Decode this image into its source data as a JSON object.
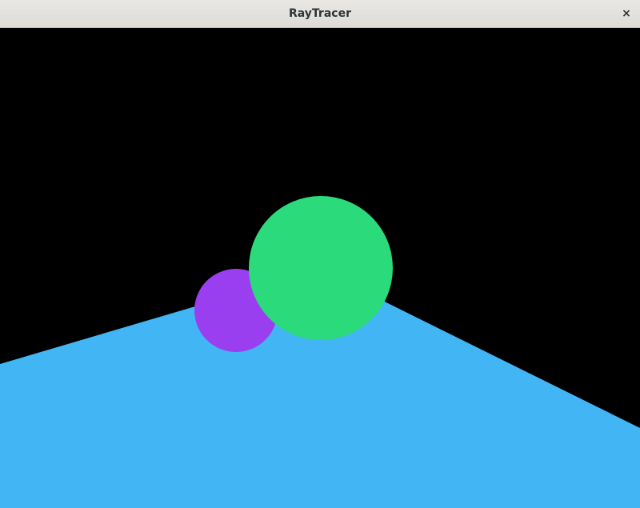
{
  "window": {
    "title": "RayTracer",
    "close_glyph": "×",
    "close_icon": "close-icon"
  },
  "scene": {
    "background_color": "#000000",
    "plane_color": "#42b5f4",
    "spheres": [
      {
        "name": "purple-sphere",
        "color": "#9a3ff0"
      },
      {
        "name": "green-sphere",
        "color": "#2bdb7b"
      }
    ]
  }
}
